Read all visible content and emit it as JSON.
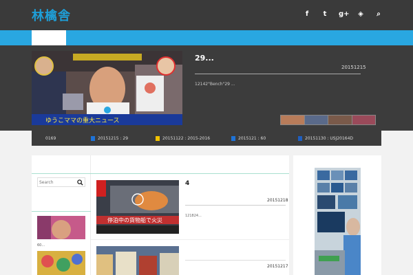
{
  "site": {
    "logo": "林檎舎"
  },
  "social": [
    {
      "label": "f",
      "icon": "facebook-icon"
    },
    {
      "label": "t",
      "icon": "twitter-icon"
    },
    {
      "label": "g+",
      "icon": "google-plus-icon"
    },
    {
      "label": "◈",
      "icon": "feedly-icon"
    },
    {
      "label": "⌕",
      "icon": "search-icon"
    }
  ],
  "hero": {
    "title": "29...",
    "date": "20151215",
    "excerpt": "12142\"Bench\"29 ...",
    "image_caption": "ゆうこママの重大ニュース"
  },
  "ticker": [
    {
      "text": "0169",
      "color": ""
    },
    {
      "text": "20151215 : 29",
      "color": "#1e73d8"
    },
    {
      "text": "20151122 : 2015-2016",
      "color": "#f2c200"
    },
    {
      "text": "2015121 : 60",
      "color": "#1e73d8"
    },
    {
      "text": "20151130 : USJ20164D",
      "color": "#1f5fbf"
    }
  ],
  "sidebar": {
    "search_placeholder": "Search",
    "caption1": "60..."
  },
  "posts": [
    {
      "title": "4",
      "date": "20151218",
      "excerpt": "121824...",
      "image_caption": "停泊中の貨物船で火災"
    },
    {
      "title": "",
      "date": "20151217",
      "excerpt": ""
    }
  ],
  "colors": {
    "accent": "#29a7e1",
    "logo": "#1e9fd8",
    "dark": "#3c3c3c"
  }
}
